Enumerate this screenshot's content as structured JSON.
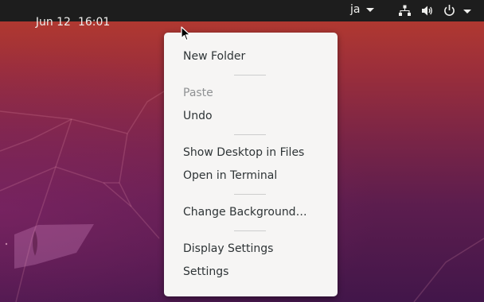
{
  "topbar": {
    "date": "Jun 12",
    "time": "16:01",
    "input_method": "ja",
    "icons": [
      "network-icon",
      "volume-icon",
      "power-icon"
    ]
  },
  "context_menu": {
    "items": [
      {
        "label": "New Folder",
        "enabled": true
      },
      {
        "label": "Paste",
        "enabled": false
      },
      {
        "label": "Undo",
        "enabled": true
      },
      {
        "label": "Show Desktop in Files",
        "enabled": true
      },
      {
        "label": "Open in Terminal",
        "enabled": true
      },
      {
        "label": "Change Background…",
        "enabled": true
      },
      {
        "label": "Display Settings",
        "enabled": true
      },
      {
        "label": "Settings",
        "enabled": true
      }
    ]
  },
  "colors": {
    "topbar_bg": "#1d1d1d",
    "menu_bg": "#f6f5f4",
    "menu_text": "#2e3436",
    "menu_text_disabled": "#8f9193"
  }
}
